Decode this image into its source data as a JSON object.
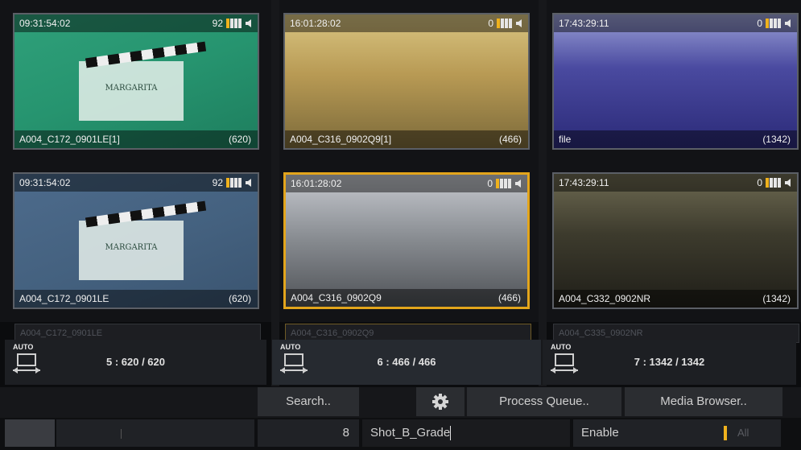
{
  "clips": [
    {
      "id": "r1c1",
      "timecode": "09:31:54:02",
      "level": "92",
      "name": "A004_C172_0901LE[1]",
      "count": "(620)",
      "style": "img-green",
      "selected": false,
      "slate": "MARGARITA"
    },
    {
      "id": "r1c2",
      "timecode": "16:01:28:02",
      "level": "0",
      "name": "A004_C316_0902Q9[1]",
      "count": "(466)",
      "style": "img-sepia",
      "selected": false,
      "slate": ""
    },
    {
      "id": "r1c3",
      "timecode": "17:43:29:11",
      "level": "0",
      "name": "file",
      "count": "(1342)",
      "style": "img-sea",
      "selected": false,
      "slate": ""
    },
    {
      "id": "r2c1",
      "timecode": "09:31:54:02",
      "level": "92",
      "name": "A004_C172_0901LE",
      "count": "(620)",
      "style": "img-blue",
      "selected": false,
      "slate": "MARGARITA"
    },
    {
      "id": "r2c2",
      "timecode": "16:01:28:02",
      "level": "0",
      "name": "A004_C316_0902Q9",
      "count": "(466)",
      "style": "img-sepia2",
      "selected": true,
      "slate": ""
    },
    {
      "id": "r2c3",
      "timecode": "17:43:29:11",
      "level": "0",
      "name": "A004_C332_0902NR",
      "count": "(1342)",
      "style": "img-dusk",
      "selected": false,
      "slate": ""
    }
  ],
  "peeks": [
    "A004_C172_0901LE",
    "A004_C316_0902Q9",
    "A004_C335_0902NR"
  ],
  "nav": [
    {
      "auto_label": "AUTO",
      "count": "5 : 620 / 620"
    },
    {
      "auto_label": "AUTO",
      "count": "6 : 466 / 466"
    },
    {
      "auto_label": "AUTO",
      "count": "7 : 1342 / 1342"
    }
  ],
  "toolbar": {
    "search": "Search..",
    "process_queue": "Process Queue..",
    "media_browser": "Media Browser.."
  },
  "status": {
    "number": "8",
    "shot_name": "Shot_B_Grade",
    "enable": "Enable",
    "all": "All"
  },
  "colors": {
    "accent": "#e3a51c",
    "level_bar": "#f0b21d"
  }
}
